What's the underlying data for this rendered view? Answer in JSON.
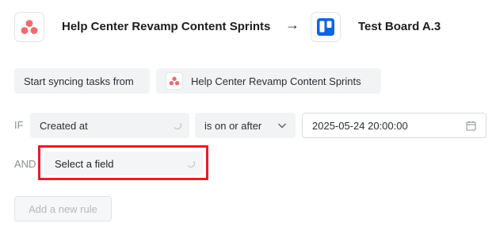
{
  "header": {
    "source_title": "Help Center Revamp Content Sprints",
    "arrow": "→",
    "target_title": "Test Board A.3",
    "source_icon": "asana-logo-icon",
    "target_icon": "trello-logo-icon"
  },
  "sync": {
    "label": "Start syncing tasks from",
    "project": "Help Center Revamp Content Sprints"
  },
  "rules": {
    "if_keyword": "IF",
    "and_keyword": "AND",
    "field": "Created at",
    "operator": "is on or after",
    "value": "2025-05-24 20:00:00",
    "new_field_placeholder": "Select a field"
  },
  "add_rule_label": "Add a new rule",
  "colors": {
    "asana": "#f06a6a",
    "trello": "#0c66e4",
    "highlight": "#e0202a"
  }
}
